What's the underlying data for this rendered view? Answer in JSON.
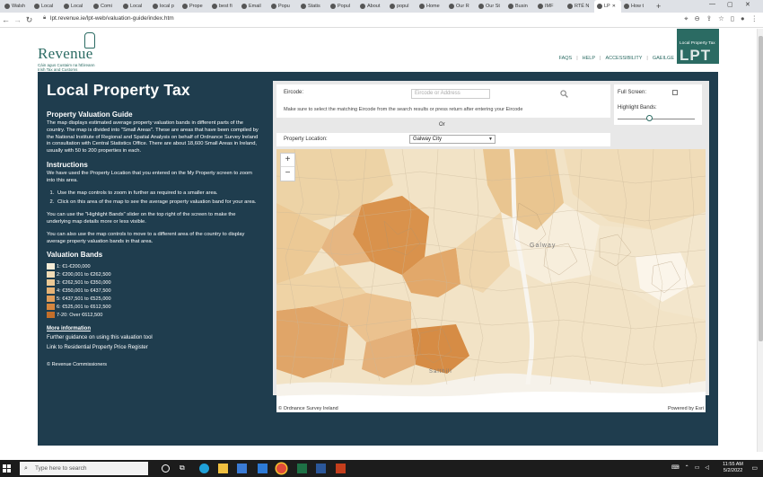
{
  "browser": {
    "tabs": [
      {
        "label": "Walsh"
      },
      {
        "label": "Local"
      },
      {
        "label": "Local"
      },
      {
        "label": "Comi"
      },
      {
        "label": "Local"
      },
      {
        "label": "local p"
      },
      {
        "label": "Prope"
      },
      {
        "label": "best fi"
      },
      {
        "label": "Email"
      },
      {
        "label": "Popu"
      },
      {
        "label": "Statis"
      },
      {
        "label": "Popul"
      },
      {
        "label": "About"
      },
      {
        "label": "popul"
      },
      {
        "label": "Home"
      },
      {
        "label": "Our R"
      },
      {
        "label": "Our St"
      },
      {
        "label": "Busin"
      },
      {
        "label": "IMF"
      },
      {
        "label": "RTÉ N"
      },
      {
        "label": "LP"
      },
      {
        "label": "How t"
      }
    ],
    "url": "lpt.revenue.ie/lpt-web/valuation-guide/index.htm"
  },
  "header": {
    "logo_word": "Revenue",
    "logo_sub1": "Cáin agus Custaim na hÉireann",
    "logo_sub2": "Irish Tax and Customs",
    "links": [
      "FAQS",
      "HELP",
      "ACCESSIBILITY",
      "GAEILGE"
    ],
    "badge_text": "Local Property Tax",
    "badge_big": "LPT"
  },
  "left": {
    "title": "Local Property Tax",
    "guide_heading": "Property Valuation Guide",
    "guide_text": "The map displays estimated average property valuation bands in different parts of the country. The map is divided into \"Small Areas\". These are areas that have been compiled by the National Institute of Regional and Spatial Analysis on behalf of Ordnance Survey Ireland in consultation with Central Statistics Office. There are about 18,600 Small Areas in Ireland, usually with 50 to 200 properties in each.",
    "instructions_heading": "Instructions",
    "instructions_text": "We have used the Property Location that you entered on the My Property screen to zoom into this area.",
    "steps": [
      "Use the map controls to zoom in further as required to a smaller area.",
      "Click on this area of the map to see the average property valuation band for your area."
    ],
    "highlight_text": "You can use the \"Highlight Bands\" slider on the top right of the screen to make the underlying map details more or less visible.",
    "move_text": "You can also use the map controls to move to a different area of the country to display average property valuation bands in that area.",
    "bands_heading": "Valuation Bands",
    "bands": [
      {
        "label": "1: €1-€200,000",
        "color": "#f6ecd6"
      },
      {
        "label": "2: €200,001 to €262,500",
        "color": "#f1dcb6"
      },
      {
        "label": "3: €262,501 to €350,000",
        "color": "#ecc995"
      },
      {
        "label": "4: €350,001 to €437,500",
        "color": "#e6b376"
      },
      {
        "label": "5: €437,501 to €525,000",
        "color": "#df9d5b"
      },
      {
        "label": "6: €525,001 to €612,500",
        "color": "#d5863f"
      },
      {
        "label": "7-20: Over €612,500",
        "color": "#c46f2a"
      }
    ],
    "more_info": "More information",
    "further_link": "Further guidance on using this valuation tool",
    "register_link": "Link to Residential Property Price Register",
    "copyright": "© Revenue Commissioners"
  },
  "controls": {
    "eircode_label": "Eircode:",
    "eircode_placeholder": "Eircode or Address",
    "eircode_hint": "Make sure to select the matching Eircode from the search results or press return after entering your Eircode",
    "or_text": "Or",
    "location_label": "Property Location:",
    "location_value": "Galway City",
    "fullscreen_label": "Full Screen:",
    "highlight_label": "Highlight Bands:",
    "highlight_level": 0.4
  },
  "map": {
    "zoom_in": "+",
    "zoom_out": "−",
    "city_label": "Galway",
    "area_label": "Salthill",
    "attribution_left": "© Ordnance Survey Ireland",
    "attribution_right": "Powered by Esri"
  },
  "taskbar": {
    "search_placeholder": "Type here to search",
    "time": "11:55 AM",
    "date": "5/2/2022"
  }
}
